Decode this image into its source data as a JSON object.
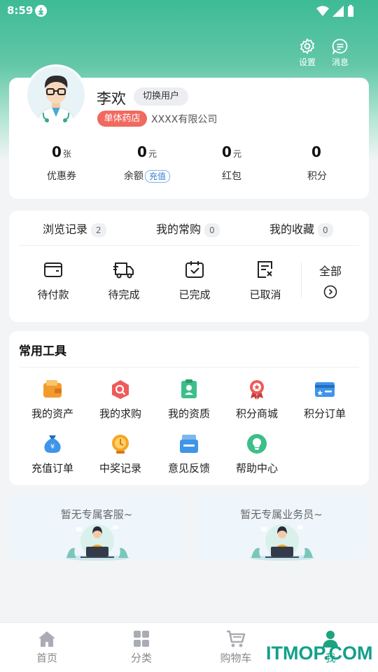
{
  "status_bar": {
    "time": "8:59"
  },
  "header": {
    "settings_label": "设置",
    "messages_label": "消息"
  },
  "profile": {
    "name": "李欢",
    "switch_user_label": "切换用户",
    "store_type_tag": "单体药店",
    "company": "XXXX有限公司",
    "stats": [
      {
        "value": "0",
        "unit": "张",
        "label": "优惠券"
      },
      {
        "value": "0",
        "unit": "元",
        "label": "余额",
        "action": "充值"
      },
      {
        "value": "0",
        "unit": "元",
        "label": "红包"
      },
      {
        "value": "0",
        "unit": "",
        "label": "积分"
      }
    ]
  },
  "order_section": {
    "tabs": [
      {
        "label": "浏览记录",
        "count": "2"
      },
      {
        "label": "我的常购",
        "count": "0"
      },
      {
        "label": "我的收藏",
        "count": "0"
      }
    ],
    "statuses": [
      {
        "label": "待付款",
        "icon": "wallet-icon"
      },
      {
        "label": "待完成",
        "icon": "delivery-truck-icon"
      },
      {
        "label": "已完成",
        "icon": "completed-box-icon"
      },
      {
        "label": "已取消",
        "icon": "cancelled-document-icon"
      }
    ],
    "all_label": "全部"
  },
  "tools": {
    "title": "常用工具",
    "items": [
      {
        "label": "我的资产",
        "icon": "wallet-icon",
        "color": "#f39a2c"
      },
      {
        "label": "我的求购",
        "icon": "search-bag-icon",
        "color": "#ef5a5a"
      },
      {
        "label": "我的资质",
        "icon": "certificate-icon",
        "color": "#3cbf8a"
      },
      {
        "label": "积分商城",
        "icon": "medal-icon",
        "color": "#ef5a5a"
      },
      {
        "label": "积分订单",
        "icon": "card-icon",
        "color": "#3f95e8"
      },
      {
        "label": "充值订单",
        "icon": "money-bag-icon",
        "color": "#3f95e8"
      },
      {
        "label": "中奖记录",
        "icon": "trophy-icon",
        "color": "#f5a623"
      },
      {
        "label": "意见反馈",
        "icon": "feedback-icon",
        "color": "#3f95e8"
      },
      {
        "label": "帮助中心",
        "icon": "bulb-icon",
        "color": "#3cbf8a"
      }
    ]
  },
  "service_cards": [
    {
      "label": "暂无专属客服~"
    },
    {
      "label": "暂无专属业务员~"
    }
  ],
  "tab_bar": {
    "items": [
      {
        "label": "首页",
        "icon": "home-icon"
      },
      {
        "label": "分类",
        "icon": "category-icon"
      },
      {
        "label": "购物车",
        "icon": "cart-icon"
      },
      {
        "label": "我",
        "icon": "person-icon",
        "active": true
      }
    ]
  },
  "watermark": "ITMOP.COM",
  "colors": {
    "accent": "#1fa37f",
    "tag": "#f06a5f",
    "link": "#2f7fd6"
  }
}
